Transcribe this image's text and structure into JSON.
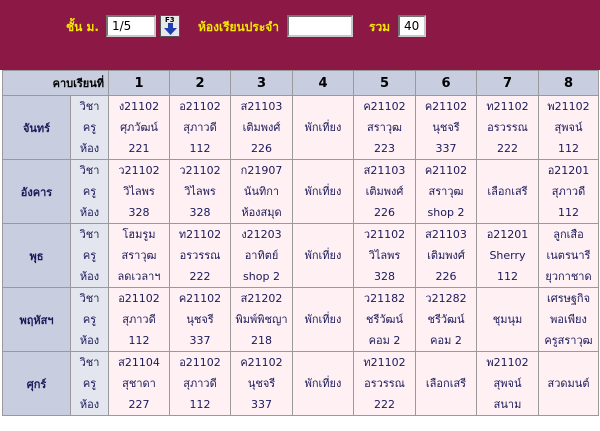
{
  "header": {
    "class_label": "ชั้น ม.",
    "class_value": "1/5",
    "f3_label": "F3",
    "room_label": "ห้องเรียนประจำ",
    "room_value": "",
    "total_label": "รวม",
    "total_value": "40"
  },
  "grid": {
    "period_header": "คาบเรียนที่",
    "periods": [
      "1",
      "2",
      "3",
      "4",
      "5",
      "6",
      "7",
      "8"
    ],
    "row_labels": [
      "วิชา",
      "ครู",
      "ห้อง"
    ],
    "days": [
      {
        "name": "จันทร์",
        "slots": [
          [
            "ง21102",
            "ศุภวัฒน์",
            "221"
          ],
          [
            "อ21102",
            "สุภาวดี",
            "112"
          ],
          [
            "ส21103",
            "เติมพงศ์",
            "226"
          ],
          [
            "พักเที่ยง"
          ],
          [
            "ค21102",
            "สราวุฒ",
            "223"
          ],
          [
            "ค21102",
            "นุชจรี",
            "337"
          ],
          [
            "ท21102",
            "อรวรรณ",
            "222"
          ],
          [
            "พ21102",
            "สุพจน์",
            "112"
          ]
        ]
      },
      {
        "name": "อังคาร",
        "slots": [
          [
            "ว21102",
            "วิไลพร",
            "328"
          ],
          [
            "ว21102",
            "วิไลพร",
            "328"
          ],
          [
            "ก21907",
            "นันทิกา",
            "ห้องสมุด"
          ],
          [
            "พักเที่ยง"
          ],
          [
            "ส21103",
            "เติมพงศ์",
            "226"
          ],
          [
            "ค21102",
            "สราวุฒ",
            "shop 2"
          ],
          [
            "เลือกเสรี"
          ],
          [
            "อ21201",
            "สุภาวดี",
            "112"
          ]
        ]
      },
      {
        "name": "พุธ",
        "slots": [
          [
            "โฮมรูม",
            "สราวุฒ",
            "ลดเวลาฯ"
          ],
          [
            "ท21102",
            "อรวรรณ",
            "222"
          ],
          [
            "ง21203",
            "อาทิตย์",
            "shop 2"
          ],
          [
            "พักเที่ยง"
          ],
          [
            "ว21102",
            "วิไลพร",
            "328"
          ],
          [
            "ส21103",
            "เติมพงศ์",
            "226"
          ],
          [
            "อ21201",
            "Sherry",
            "112"
          ],
          [
            "ลูกเสือ",
            "เนตรนารี",
            "ยุวกาชาด"
          ]
        ]
      },
      {
        "name": "พฤหัสฯ",
        "slots": [
          [
            "อ21102",
            "สุภาวดี",
            "112"
          ],
          [
            "ค21102",
            "นุชจรี",
            "337"
          ],
          [
            "ส21202",
            "พิมพ์พิชญา",
            "218"
          ],
          [
            "พักเที่ยง"
          ],
          [
            "ว21182",
            "ชรีวัฒน์",
            "คอม 2"
          ],
          [
            "ว21282",
            "ชรีวัฒน์",
            "คอม 2"
          ],
          [
            "ชุมนุม"
          ],
          [
            "เศรษฐกิจ",
            "พอเพียง",
            "ครูสราวุฒ"
          ]
        ]
      },
      {
        "name": "ศุกร์",
        "slots": [
          [
            "ส21104",
            "สุชาดา",
            "227"
          ],
          [
            "อ21102",
            "สุภาวดี",
            "112"
          ],
          [
            "ค21102",
            "นุชจรี",
            "337"
          ],
          [
            "พักเที่ยง"
          ],
          [
            "ท21102",
            "อรวรรณ",
            "222"
          ],
          [
            "เลือกเสรี"
          ],
          [
            "พ21102",
            "สุพจน์",
            "สนาม"
          ],
          [
            "สวดมนต์"
          ]
        ]
      }
    ]
  },
  "colors": {
    "header_bg": "#8c1846",
    "header_text": "#f7e600",
    "grid_header_bg": "#c8cde0",
    "cell_bg": "#fff0f4",
    "day_text": "#1c1c8a"
  }
}
